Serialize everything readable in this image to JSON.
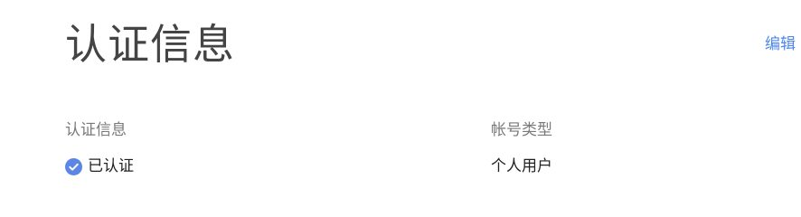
{
  "header": {
    "title": "认证信息",
    "edit_label": "编辑"
  },
  "fields": {
    "certification": {
      "label": "认证信息",
      "value": "已认证",
      "icon": "check-circle-icon"
    },
    "account_type": {
      "label": "帐号类型",
      "value": "个人用户"
    }
  },
  "colors": {
    "accent": "#4f86ec",
    "verified_icon": "#5b86e5"
  }
}
